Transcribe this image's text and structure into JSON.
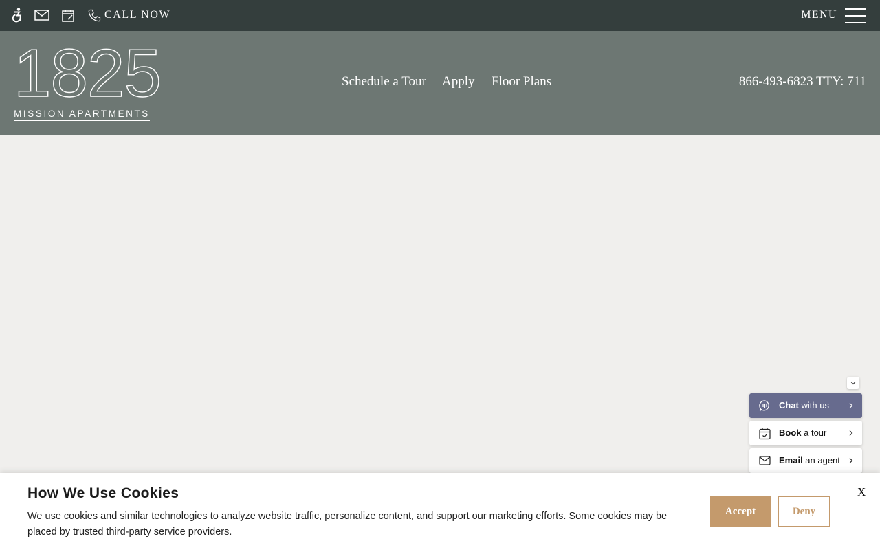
{
  "topbar": {
    "icons": [
      "accessibility-icon",
      "mail-icon",
      "calendar-icon",
      "phone-icon"
    ],
    "call_label": "CALL NOW",
    "menu_label": "MENU"
  },
  "header": {
    "logo_number": "1825",
    "logo_subtitle": "MISSION APARTMENTS",
    "nav": [
      "Schedule a Tour",
      "Apply",
      "Floor Plans"
    ],
    "phone": "866-493-6823 TTY: 711"
  },
  "widgets": {
    "chat": {
      "bold": "Chat",
      "rest": " with us"
    },
    "book": {
      "bold": "Book",
      "rest": " a tour"
    },
    "email": {
      "bold": "Email",
      "rest": " an agent"
    }
  },
  "cookie": {
    "title": "How We Use Cookies",
    "text": "We use cookies and similar technologies to analyze website traffic, personalize content, and support our marketing efforts. Some cookies may be placed by trusted third-party service providers.",
    "accept_label": "Accept",
    "deny_label": "Deny",
    "close_label": "X"
  },
  "colors": {
    "topbar": "#343e3d",
    "header": "#6d7773",
    "page_background": "#f0efed",
    "chat_widget": "#676b8e",
    "accent": "#c49a6c"
  }
}
